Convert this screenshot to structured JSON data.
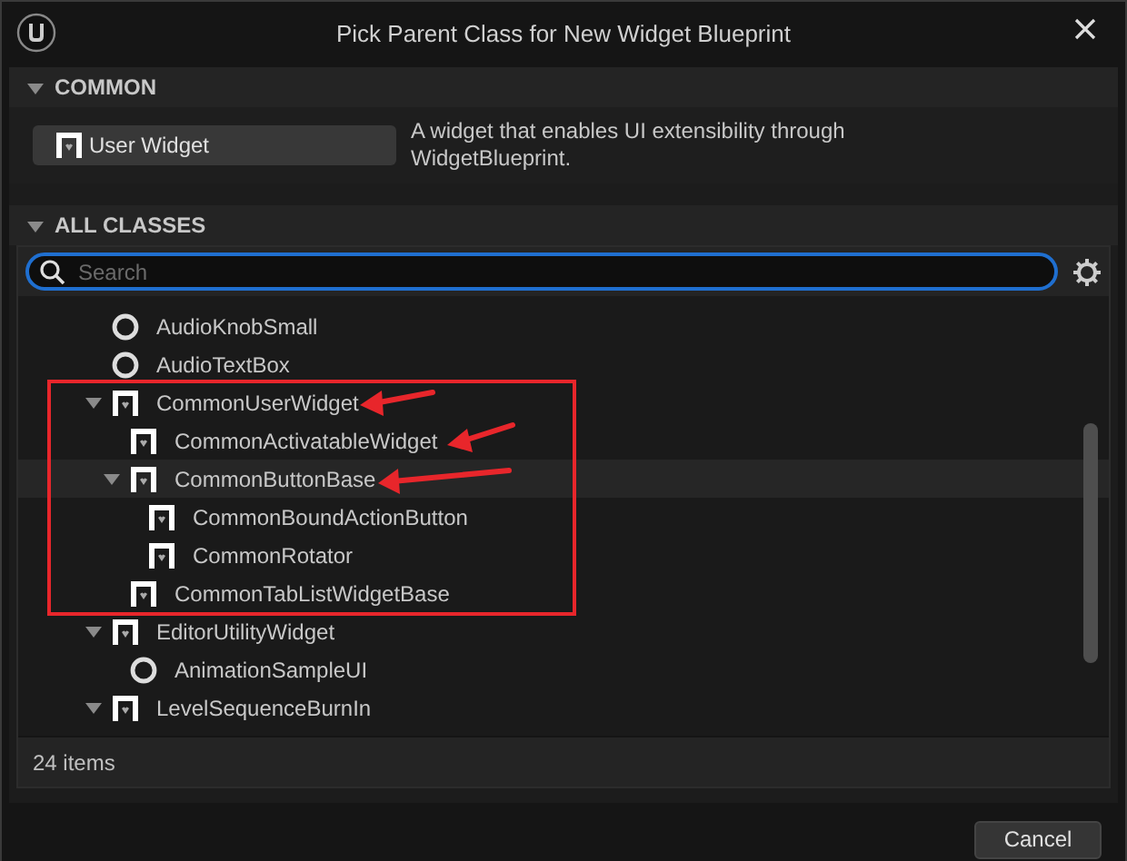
{
  "window": {
    "title": "Pick Parent Class for New Widget Blueprint"
  },
  "common": {
    "header": "COMMON",
    "expanded": true,
    "button": "User Widget",
    "description": "A widget that enables UI extensibility through WidgetBlueprint."
  },
  "all_classes": {
    "header": "ALL CLASSES",
    "expanded": true,
    "search": {
      "placeholder": "Search"
    },
    "tree": [
      {
        "label": "AudioKnobSmall",
        "kind": "asset",
        "highlighted": false
      },
      {
        "label": "AudioTextBox",
        "kind": "asset",
        "highlighted": false
      },
      {
        "label": "CommonUserWidget",
        "kind": "widget",
        "highlighted": false,
        "expanded": true,
        "children": [
          {
            "label": "CommonActivatableWidget",
            "kind": "widget",
            "highlighted": false
          },
          {
            "label": "CommonButtonBase",
            "kind": "widget",
            "highlighted": true,
            "expanded": true,
            "children": [
              {
                "label": "CommonBoundActionButton",
                "kind": "widget",
                "highlighted": false
              },
              {
                "label": "CommonRotator",
                "kind": "widget",
                "highlighted": false
              }
            ]
          },
          {
            "label": "CommonTabListWidgetBase",
            "kind": "widget",
            "highlighted": false
          }
        ]
      },
      {
        "label": "EditorUtilityWidget",
        "kind": "widget",
        "highlighted": false,
        "expanded": true,
        "children": [
          {
            "label": "AnimationSampleUI",
            "kind": "asset",
            "highlighted": false
          }
        ]
      },
      {
        "label": "LevelSequenceBurnIn",
        "kind": "widget",
        "highlighted": false,
        "expanded": true
      }
    ],
    "item_count": "24 items"
  },
  "buttons": [
    "Cancel"
  ]
}
